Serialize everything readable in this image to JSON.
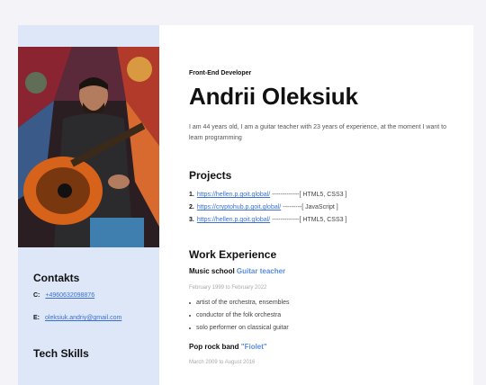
{
  "header": {
    "role": "Front-End Developer",
    "name": "Andrii Oleksiuk",
    "about": "I am 44 years old, I am a guitar teacher with 23 years of experience, at the moment I want to learn programming"
  },
  "sidebar": {
    "contacts_title": "Contakts",
    "phone_label": "C:",
    "phone": "+4960632098876",
    "email_label": "E:",
    "email": "oleksiuk.andriy@gmail.com",
    "skills_title": "Tech Skills"
  },
  "projects": {
    "title": "Projects",
    "items": [
      {
        "num": "1.",
        "link": "https://hellen.p.goit.global/",
        "tail": "-------------[ HTML5, CSS3 ]"
      },
      {
        "num": "2.",
        "link": "https://cryptohub.p.goit.global/",
        "tail": "---------[ JavaScript ]"
      },
      {
        "num": "3.",
        "link": "https://hellen.p.goit.global/",
        "tail": "-------------[ HTML5, CSS3 ]"
      }
    ]
  },
  "experience": {
    "title": "Work Experience",
    "jobs": [
      {
        "place": "Music school",
        "position": "Guitar teacher",
        "dates": "February 1999 to February 2022",
        "duties": [
          "artist of the orchestra, ensembles",
          "conductor of the folk orchestra",
          "solo performer on classical guitar"
        ]
      },
      {
        "place": "Pop rock band",
        "position": "\"Fiolet\"",
        "dates": "March 2009 to August 2016"
      }
    ]
  }
}
